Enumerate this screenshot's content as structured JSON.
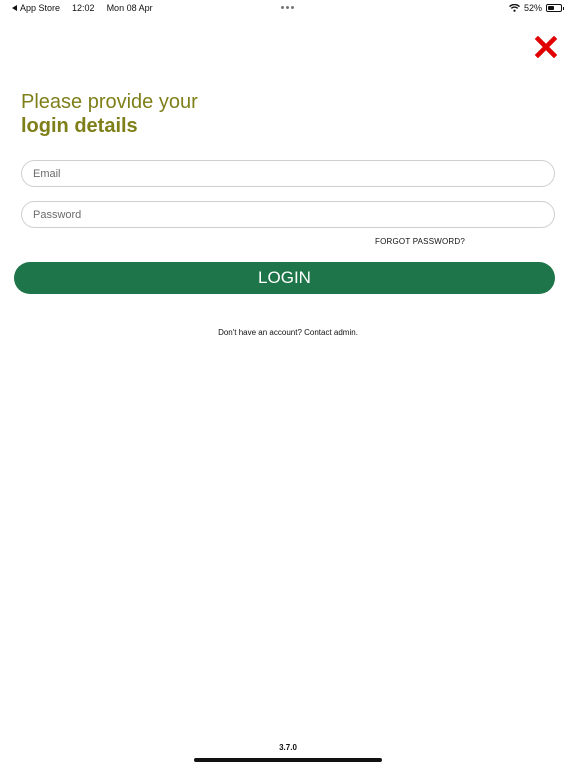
{
  "status_bar": {
    "back_app": "App Store",
    "time": "12:02",
    "date": "Mon 08 Apr",
    "battery_percent": "52%",
    "battery_level": 0.52
  },
  "close": {
    "icon": "close-icon",
    "color": "#e00000"
  },
  "heading": {
    "line1": "Please provide your",
    "line2": "login details",
    "color": "#7f7f1a"
  },
  "form": {
    "email_placeholder": "Email",
    "email_value": "",
    "password_placeholder": "Password",
    "password_value": "",
    "forgot_label": "FORGOT PASSWORD?",
    "login_label": "LOGIN",
    "login_color": "#1e7549"
  },
  "account_note": "Don't have an account? Contact admin.",
  "version": "3.7.0"
}
